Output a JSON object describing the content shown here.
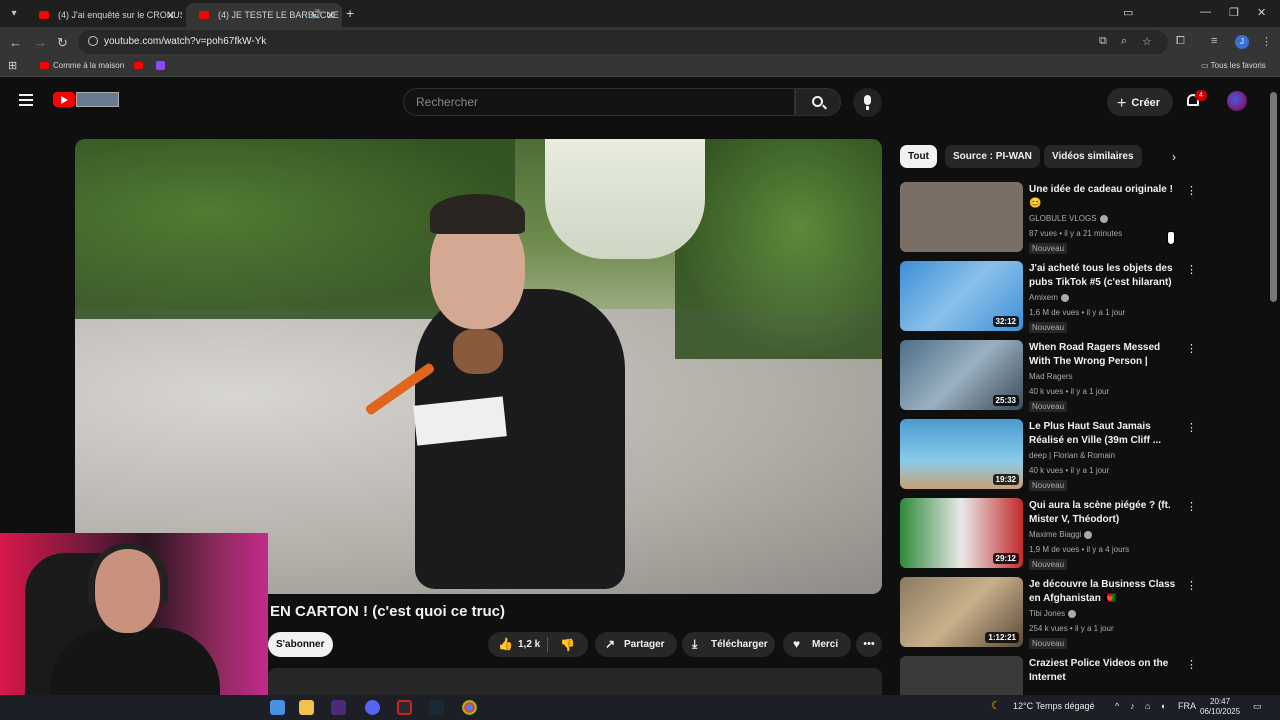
{
  "browser": {
    "tabs": [
      {
        "label": "(4) J'ai enquêté sur le CRONUS"
      },
      {
        "label": "(4) JE TESTE LE BARBECUE C"
      }
    ],
    "url": "youtube.com/watch?v=poh67fkW-Yk",
    "profile_initial": "J",
    "bookmarks": [
      {
        "label": "Comme à la maison"
      }
    ],
    "all_bookmarks_label": "Tous les favoris"
  },
  "youtube": {
    "search_placeholder": "Rechercher",
    "create_label": "Créer",
    "notification_count": "4"
  },
  "video": {
    "title": "EN CARTON ! (c'est quoi ce truc)",
    "subscribe_label": "S'abonner",
    "like_count": "1,2 k",
    "share_label": "Partager",
    "download_label": "Télécharger",
    "thanks_label": "Merci"
  },
  "chips": [
    {
      "label": "Tout"
    },
    {
      "label": "Source : PI-WAN"
    },
    {
      "label": "Vidéos similaires"
    }
  ],
  "related": [
    {
      "title": "Une idée de cadeau originale ! 😊",
      "channel": "GLOBULE VLOGS",
      "meta": "87 vues • il y a 21 minutes",
      "badge": "Nouveau",
      "duration": "",
      "thumb_color": "#7a6f66"
    },
    {
      "title": "J'ai acheté tous les objets des pubs TikTok #5 (c'est hilarant)",
      "channel": "Amixem",
      "meta": "1,6 M de vues • il y a 1 jour",
      "badge": "Nouveau",
      "duration": "32:12",
      "thumb_color": "#3c8fd6"
    },
    {
      "title": "When Road Ragers Messed With The Wrong Person | Insta...",
      "channel": "Mad Ragers",
      "meta": "40 k vues • il y a 1 jour",
      "badge": "Nouveau",
      "duration": "25:33",
      "thumb_color": "#4d6f8a"
    },
    {
      "title": "Le Plus Haut Saut Jamais Réalisé en Ville (39m Cliff ...",
      "channel": "deep | Florian & Romain",
      "meta": "40 k vues • il y a 1 jour",
      "badge": "Nouveau",
      "duration": "19:32",
      "thumb_color": "#4a9ad0"
    },
    {
      "title": "Qui aura la scène piégée ? (ft. Mister V, Théodort)",
      "channel": "Maxime Biaggi",
      "meta": "1,9 M de vues • il y a 4 jours",
      "badge": "Nouveau",
      "duration": "29:12",
      "thumb_color": "#2f8a3a"
    },
    {
      "title": "Je découvre la Business Class en Afghanistan 🇦🇫",
      "channel": "Tibi Jones",
      "meta": "254 k vues • il y a 1 jour",
      "badge": "Nouveau",
      "duration": "1:12:21",
      "thumb_color": "#8a7a62"
    },
    {
      "title": "Craziest Police Videos on the Internet",
      "channel": "",
      "meta": "",
      "badge": "",
      "duration": "",
      "thumb_color": "#3a3a3a"
    }
  ],
  "taskbar": {
    "weather": "12°C  Temps dégagé",
    "language": "FRA",
    "time": "20:47",
    "date": "06/10/2025"
  }
}
